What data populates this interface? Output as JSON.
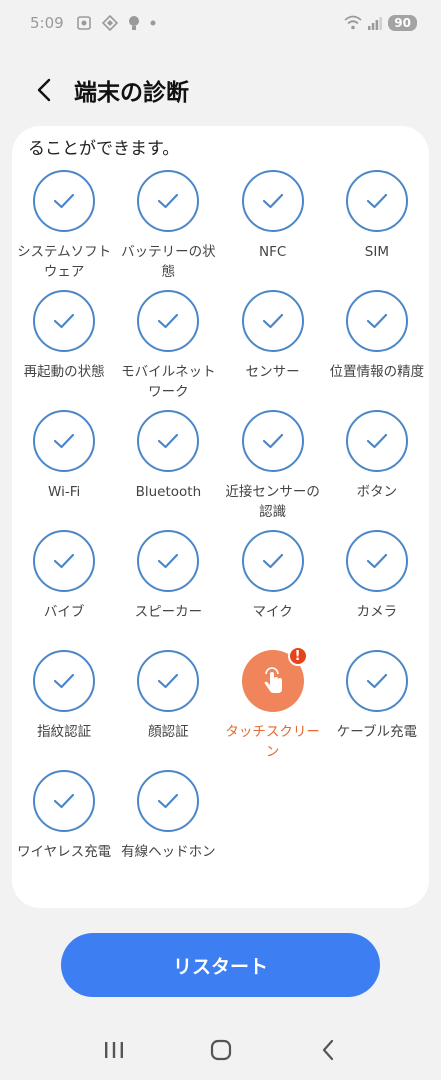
{
  "status": {
    "time": "5:09",
    "battery": "90"
  },
  "header": {
    "title": "端末の診断"
  },
  "description": {
    "partial_line": "ることができます。"
  },
  "items": [
    {
      "label": "システムソフトウェア",
      "state": "ok"
    },
    {
      "label": "バッテリーの状態",
      "state": "ok"
    },
    {
      "label": "NFC",
      "state": "ok"
    },
    {
      "label": "SIM",
      "state": "ok"
    },
    {
      "label": "再起動の状態",
      "state": "ok"
    },
    {
      "label": "モバイルネットワーク",
      "state": "ok"
    },
    {
      "label": "センサー",
      "state": "ok"
    },
    {
      "label": "位置情報の精度",
      "state": "ok"
    },
    {
      "label": "Wi-Fi",
      "state": "ok"
    },
    {
      "label": "Bluetooth",
      "state": "ok"
    },
    {
      "label": "近接センサーの認識",
      "state": "ok"
    },
    {
      "label": "ボタン",
      "state": "ok"
    },
    {
      "label": "バイブ",
      "state": "ok"
    },
    {
      "label": "スピーカー",
      "state": "ok"
    },
    {
      "label": "マイク",
      "state": "ok"
    },
    {
      "label": "カメラ",
      "state": "ok"
    },
    {
      "label": "指紋認証",
      "state": "ok"
    },
    {
      "label": "顔認証",
      "state": "ok"
    },
    {
      "label": "タッチスクリーン",
      "state": "warning"
    },
    {
      "label": "ケーブル充電",
      "state": "ok"
    },
    {
      "label": "ワイヤレス充電",
      "state": "ok"
    },
    {
      "label": "有線ヘッドホン",
      "state": "ok"
    }
  ],
  "badge": "!",
  "restart_label": "リスタート",
  "colors": {
    "accent": "#3d7ef2",
    "check_ring": "#4a86c8",
    "warning": "#f0855b",
    "warning_badge": "#e7431b"
  }
}
